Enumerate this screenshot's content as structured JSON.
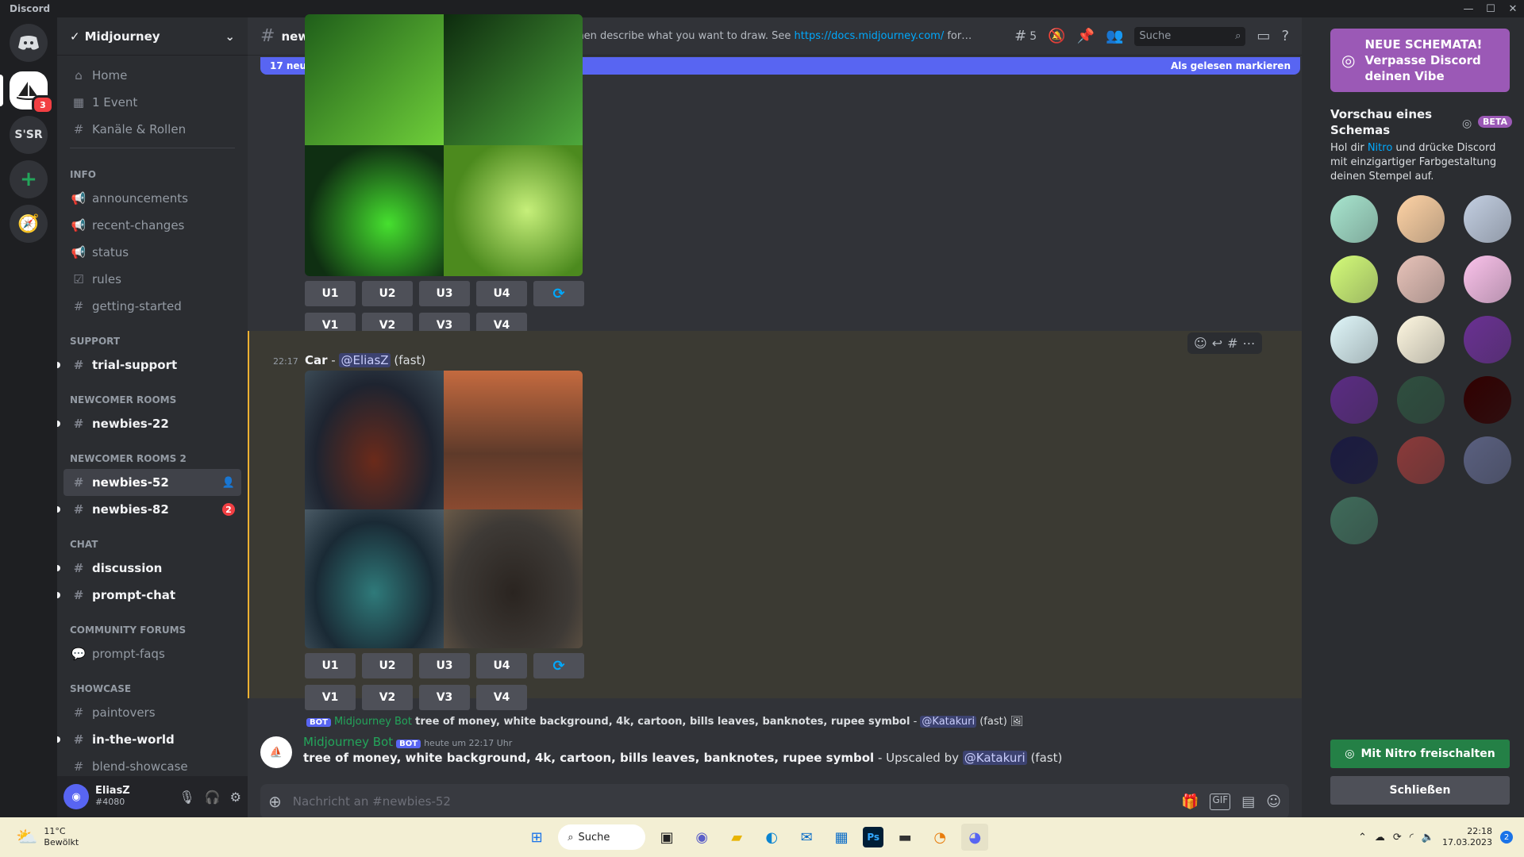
{
  "window": {
    "title": "Discord"
  },
  "servers": {
    "midjourney_badge": "3",
    "ssr_label": "S'SR"
  },
  "guild": {
    "name": "Midjourney"
  },
  "nav": {
    "home": "Home",
    "event": "1 Event",
    "channels_roles": "Kanäle & Rollen"
  },
  "categories": {
    "info": "INFO",
    "support": "SUPPORT",
    "newcomer": "NEWCOMER ROOMS",
    "newcomer2": "NEWCOMER ROOMS 2",
    "chat": "CHAT",
    "forums": "COMMUNITY FORUMS",
    "showcase": "SHOWCASE"
  },
  "channels": {
    "announcements": "announcements",
    "recent_changes": "recent-changes",
    "status": "status",
    "rules": "rules",
    "getting_started": "getting-started",
    "trial_support": "trial-support",
    "newbies_22": "newbies-22",
    "newbies_52": "newbies-52",
    "newbies_82": "newbies-82",
    "newbies_82_count": "2",
    "discussion": "discussion",
    "prompt_chat": "prompt-chat",
    "prompt_faqs": "prompt-faqs",
    "paintovers": "paintovers",
    "in_the_world": "in-the-world",
    "blend_showcase": "blend-showcase"
  },
  "user": {
    "name": "EliasZ",
    "tag": "#4080"
  },
  "channel_header": {
    "name": "newbies-52",
    "topic_pre": "Bot room for new users. Type /imagine then describe what you want to draw. See ",
    "topic_link": "https://docs.midjourney.com/",
    "topic_post": " for more info...",
    "threads_count": "5",
    "search_placeholder": "Suche"
  },
  "new_messages": {
    "text": "17 neue Nachrichten seit 22:17",
    "mark_read": "Als gelesen markieren"
  },
  "upscale_buttons": [
    "U1",
    "U2",
    "U3",
    "U4"
  ],
  "variation_buttons": [
    "V1",
    "V2",
    "V3",
    "V4"
  ],
  "car_message": {
    "time": "22:17",
    "prompt": "Car",
    "sep": " - ",
    "mention": "@EliasZ",
    "mode": "(fast)"
  },
  "reply": {
    "bot_name": "Midjourney Bot",
    "bot_tag": "BOT",
    "text": "tree of money, white background, 4k, cartoon, bills leaves, banknotes, rupee symbol",
    "sep": " - ",
    "mention": "@Katakuri",
    "mode": "(fast)"
  },
  "bot_message": {
    "author": "Midjourney Bot",
    "tag": "BOT",
    "timestamp": "heute um 22:17 Uhr",
    "text": "tree of money, white background, 4k, cartoon, bills leaves, banknotes, rupee symbol",
    "suffix": " - Upscaled by ",
    "mention": "@Katakuri",
    "mode": "(fast)"
  },
  "composer": {
    "placeholder": "Nachricht an #newbies-52"
  },
  "right_panel": {
    "promo": "NEUE SCHEMATA! Verpasse Discord deinen Vibe",
    "preview_title": "Vorschau eines Schemas",
    "beta": "BETA",
    "desc_pre": "Hol dir ",
    "desc_link": "Nitro",
    "desc_post": " und drücke Discord mit einzigartiger Farbgestaltung deinen Stempel auf.",
    "unlock": "Mit Nitro freischalten",
    "close": "Schließen",
    "swatches": [
      "#a8e6cf",
      "#ffd3a5",
      "#c3cfe2",
      "#d4fc79",
      "#e8c3b9",
      "#fbc2eb",
      "#e0f7fa",
      "#fff8e1",
      "#6a3093",
      "#5b2c83",
      "#2f4f3f",
      "#300000",
      "#1a1a40",
      "#8b3a3a",
      "#5a6080",
      "#3f6b5a"
    ]
  },
  "taskbar": {
    "temp": "11°C",
    "weather": "Bewölkt",
    "search": "Suche",
    "time": "22:18",
    "date": "17.03.2023",
    "notif": "2"
  }
}
